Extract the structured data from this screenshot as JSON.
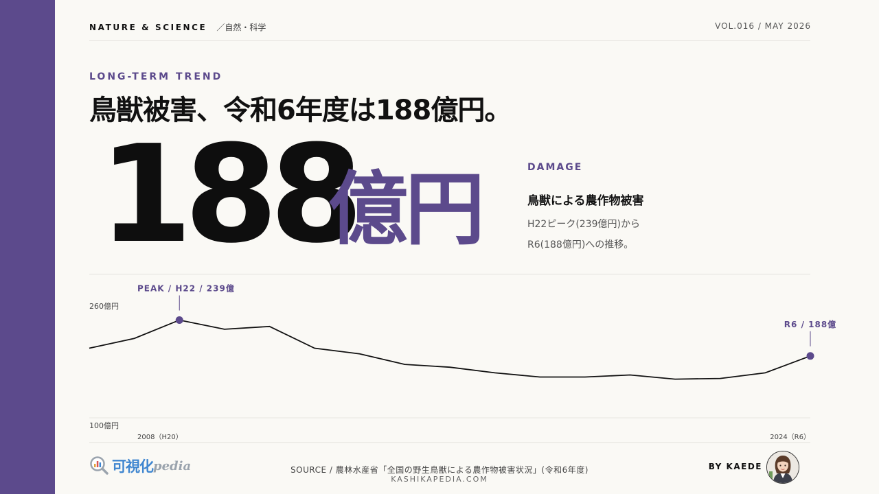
{
  "header": {
    "brand": "NATURE & SCIENCE",
    "category": "／自然・科学",
    "issue": "VOL.016 / MAY 2026"
  },
  "kicker": "LONG-TERM TREND",
  "headline": "鳥獣被害、令和6年度は188億円。",
  "hero": {
    "number": "188",
    "unit": "億円"
  },
  "damage": {
    "label": "DAMAGE",
    "title": "鳥獣による農作物被害",
    "desc_line1": "H22ピーク(239億円)から",
    "desc_line2": "R6(188億円)への推移。"
  },
  "chart_data": {
    "type": "line",
    "x": [
      2008,
      2009,
      2010,
      2011,
      2012,
      2013,
      2014,
      2015,
      2016,
      2017,
      2018,
      2019,
      2020,
      2021,
      2022,
      2023,
      2024
    ],
    "series": [
      {
        "values": [
          199,
          213,
          239,
          226,
          230,
          199,
          191,
          176,
          172,
          164,
          158,
          158,
          161,
          155,
          156,
          164,
          188
        ]
      }
    ],
    "ylim": [
      100,
      260
    ],
    "y_tick_top": "260億円",
    "y_tick_bottom": "100億円",
    "x_tick_start": "2008（H20）",
    "x_tick_end": "2024（R6）",
    "annotations": {
      "peak": "PEAK / H22 / 239億",
      "end": "R6 / 188億"
    },
    "colors": {
      "line": "#111111",
      "marker": "#5c4a8c",
      "accent": "#5c4a8c"
    }
  },
  "footer": {
    "logo_text": "可視化",
    "logo_suffix": "pedia",
    "source": "SOURCE / 農林水産省「全国の野生鳥獣による農作物被害状況」(令和6年度)",
    "site": "KASHIKAPEDIA.COM",
    "byline": "BY KAEDE"
  }
}
